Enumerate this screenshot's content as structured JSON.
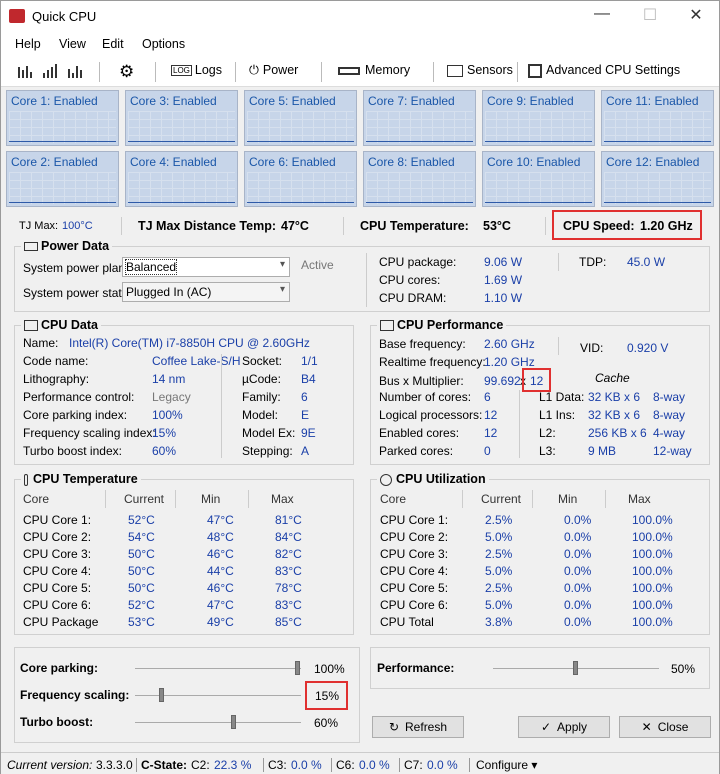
{
  "app": {
    "title": "Quick CPU",
    "minimize": "—",
    "maximize": "☐",
    "close": "✕"
  },
  "menu": [
    "Help",
    "View",
    "Edit",
    "Options"
  ],
  "toolbar": {
    "logs": "Logs",
    "power": "Power",
    "memory": "Memory",
    "sensors": "Sensors",
    "advanced": "Advanced CPU Settings"
  },
  "cores": [
    "Core 1: Enabled",
    "Core 3: Enabled",
    "Core 5: Enabled",
    "Core 7: Enabled",
    "Core 9: Enabled",
    "Core 11: Enabled",
    "Core 2: Enabled",
    "Core 4: Enabled",
    "Core 6: Enabled",
    "Core 8: Enabled",
    "Core 10: Enabled",
    "Core 12: Enabled"
  ],
  "summary": {
    "tjmax_label": "TJ Max:",
    "tjmax_value": "100°C",
    "distance_label": "TJ Max Distance Temp:",
    "distance_value": "47°C",
    "temp_label": "CPU Temperature:",
    "temp_value": "53°C",
    "speed_label": "CPU Speed:",
    "speed_value": "1.20 GHz"
  },
  "power": {
    "title": "Power Data",
    "plan_label": "System power plan:",
    "plan_value": "Balanced",
    "active": "Active",
    "state_label": "System power state:",
    "state_value": "Plugged In (AC)",
    "package_label": "CPU package:",
    "package_value": "9.06 W",
    "cores_label": "CPU cores:",
    "cores_value": "1.69 W",
    "dram_label": "CPU DRAM:",
    "dram_value": "1.10 W",
    "tdp_label": "TDP:",
    "tdp_value": "45.0 W"
  },
  "cpudata": {
    "title": "CPU Data",
    "name_label": "Name:",
    "name_value": "Intel(R) Core(TM) i7-8850H CPU @ 2.60GHz",
    "left": [
      [
        "Code name:",
        "Coffee Lake-S/H"
      ],
      [
        "Lithography:",
        "14 nm"
      ],
      [
        "Performance control:",
        "Legacy"
      ],
      [
        "Core parking index:",
        "100%"
      ],
      [
        "Frequency scaling index:",
        "15%"
      ],
      [
        "Turbo boost index:",
        "60%"
      ]
    ],
    "right": [
      [
        "Socket:",
        "1/1"
      ],
      [
        "µCode:",
        "B4"
      ],
      [
        "Family:",
        "6"
      ],
      [
        "Model:",
        "E"
      ],
      [
        "Model Ex:",
        "9E"
      ],
      [
        "Stepping:",
        "A"
      ]
    ]
  },
  "perf": {
    "title": "CPU Performance",
    "base_label": "Base frequency:",
    "base_value": "2.60 GHz",
    "vid_label": "VID:",
    "vid_value": "0.920 V",
    "rt_label": "Realtime frequency:",
    "rt_value": "1.20 GHz",
    "bus_label": "Bus x Multiplier:",
    "bus_value": "99.692",
    "mult_value": "12",
    "cache": "Cache",
    "rows": [
      [
        "Number of cores:",
        "6"
      ],
      [
        "Logical processors:",
        "12"
      ],
      [
        "Enabled cores:",
        "12"
      ],
      [
        "Parked cores:",
        "0"
      ]
    ],
    "cache_rows": [
      [
        "L1 Data:",
        "32 KB x 6",
        "8-way"
      ],
      [
        "L1 Ins:",
        "32 KB x 6",
        "8-way"
      ],
      [
        "L2:",
        "256 KB x 6",
        "4-way"
      ],
      [
        "L3:",
        "9 MB",
        "12-way"
      ]
    ]
  },
  "temp": {
    "title": "CPU Temperature",
    "headers": [
      "Core",
      "Current",
      "Min",
      "Max"
    ],
    "rows": [
      [
        "CPU Core 1:",
        "52°C",
        "47°C",
        "81°C"
      ],
      [
        "CPU Core 2:",
        "54°C",
        "48°C",
        "84°C"
      ],
      [
        "CPU Core 3:",
        "50°C",
        "46°C",
        "82°C"
      ],
      [
        "CPU Core 4:",
        "50°C",
        "44°C",
        "83°C"
      ],
      [
        "CPU Core 5:",
        "50°C",
        "46°C",
        "78°C"
      ],
      [
        "CPU Core 6:",
        "52°C",
        "47°C",
        "83°C"
      ],
      [
        "CPU Package",
        "53°C",
        "49°C",
        "85°C"
      ]
    ]
  },
  "util": {
    "title": "CPU Utilization",
    "headers": [
      "Core",
      "Current",
      "Min",
      "Max"
    ],
    "rows": [
      [
        "CPU Core 1:",
        "2.5%",
        "0.0%",
        "100.0%"
      ],
      [
        "CPU Core 2:",
        "5.0%",
        "0.0%",
        "100.0%"
      ],
      [
        "CPU Core 3:",
        "2.5%",
        "0.0%",
        "100.0%"
      ],
      [
        "CPU Core 4:",
        "5.0%",
        "0.0%",
        "100.0%"
      ],
      [
        "CPU Core 5:",
        "2.5%",
        "0.0%",
        "100.0%"
      ],
      [
        "CPU Core 6:",
        "5.0%",
        "0.0%",
        "100.0%"
      ],
      [
        "CPU Total",
        "3.8%",
        "0.0%",
        "100.0%"
      ]
    ]
  },
  "sliders": {
    "parking_label": "Core parking:",
    "parking_value": "100%",
    "parking_level": 1.0,
    "freq_label": "Frequency scaling:",
    "freq_value": "15%",
    "freq_level": 0.15,
    "turbo_label": "Turbo boost:",
    "turbo_value": "60%",
    "turbo_level": 0.6,
    "perf_label": "Performance:",
    "perf_value": "50%",
    "perf_level": 0.5
  },
  "buttons": {
    "refresh": "Refresh",
    "apply": "Apply",
    "close": "Close"
  },
  "status": {
    "version_label": "Current version:",
    "version": "3.3.3.0",
    "cstate": "C-State:",
    "c2": "C2:",
    "c2v": "22.3 %",
    "c3": "C3:",
    "c3v": "0.0 %",
    "c6": "C6:",
    "c6v": "0.0 %",
    "c7": "C7:",
    "c7v": "0.0 %",
    "configure": "Configure ▾"
  },
  "colors": {
    "value": "#1a3fa8",
    "highlight": "#e03030",
    "graph_bg": "#c7d5e9"
  }
}
